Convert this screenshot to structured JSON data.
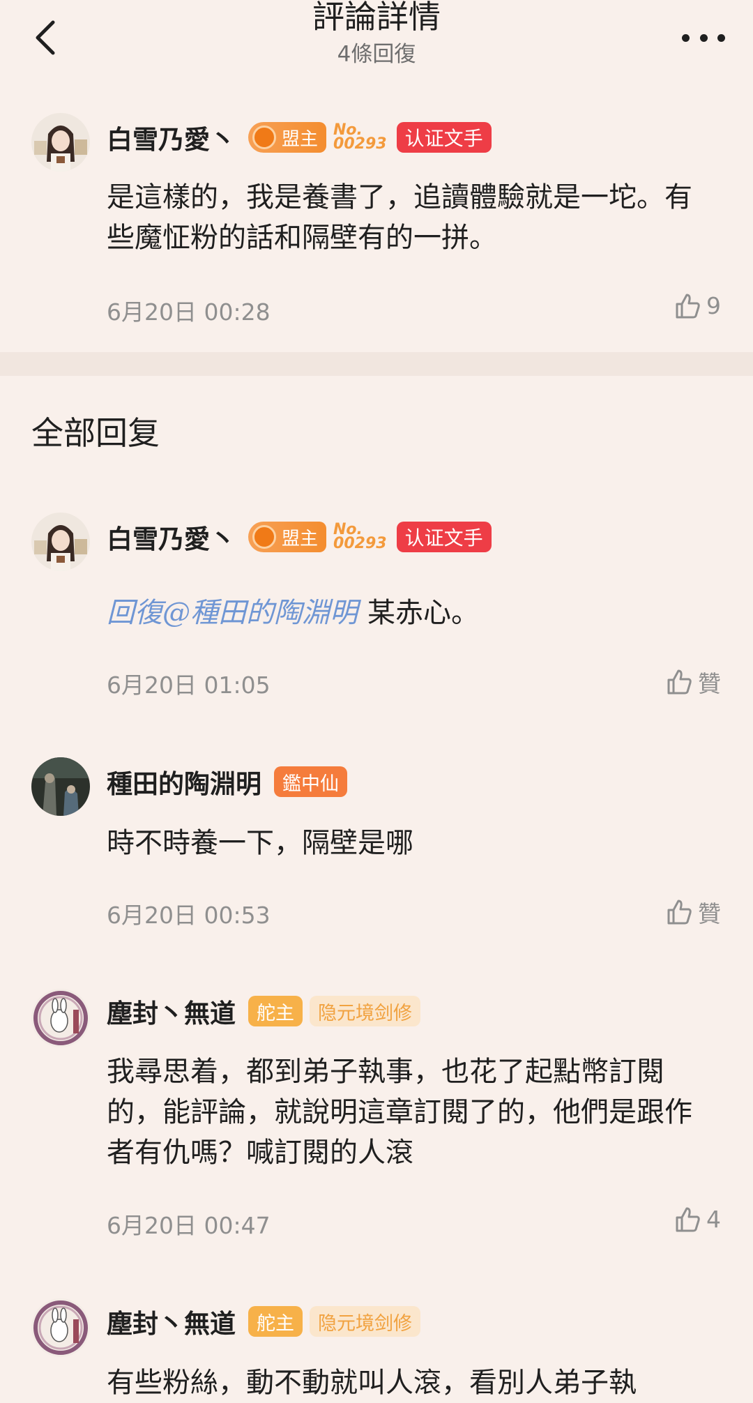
{
  "header": {
    "title": "評論詳情",
    "subtitle": "4條回復"
  },
  "main_comment": {
    "username": "白雪乃愛丶",
    "badges": {
      "lord": "盟主",
      "no_line1": "No.",
      "no_line2": "00293",
      "cert": "认证文手"
    },
    "text": "是這樣的，我是養書了，追讀體驗就是一坨。有些魔怔粉的話和隔壁有的一拼。",
    "time": "6月20日 00:28",
    "likes": "9"
  },
  "section_title": "全部回复",
  "replies": [
    {
      "username": "白雪乃愛丶",
      "badges": {
        "lord": "盟主",
        "no_line1": "No.",
        "no_line2": "00293",
        "cert": "认证文手"
      },
      "reply_to": "回復@種田的陶淵明",
      "text": "某赤心。",
      "time": "6月20日 01:05",
      "likes": "贊"
    },
    {
      "username": "種田的陶淵明",
      "badge": "鑑中仙",
      "text": "時不時養一下，隔壁是哪",
      "time": "6月20日 00:53",
      "likes": "贊"
    },
    {
      "username": "塵封丶無道",
      "badge1": "舵主",
      "badge2": "隐元境剑修",
      "text": "我尋思着，都到弟子執事，也花了起點幣訂閱的，能評論，就說明這章訂閱了的，他們是跟作者有仇嗎？喊訂閱的人滾",
      "time": "6月20日 00:47",
      "likes": "4"
    },
    {
      "username": "塵封丶無道",
      "badge1": "舵主",
      "badge2": "隐元境剑修",
      "text": "有些粉絲，動不動就叫人滾，看別人弟子執"
    }
  ],
  "colors": {
    "background": "#f9f0eb",
    "divider": "#f1e6df",
    "cert_badge": "#ee3d46",
    "lord_badge": "#f48d2f",
    "link": "#6f96d4",
    "muted": "#8f8f8f"
  },
  "icons": {
    "back": "chevron-left-icon",
    "more": "more-dots-icon",
    "like": "thumbs-up-icon"
  }
}
